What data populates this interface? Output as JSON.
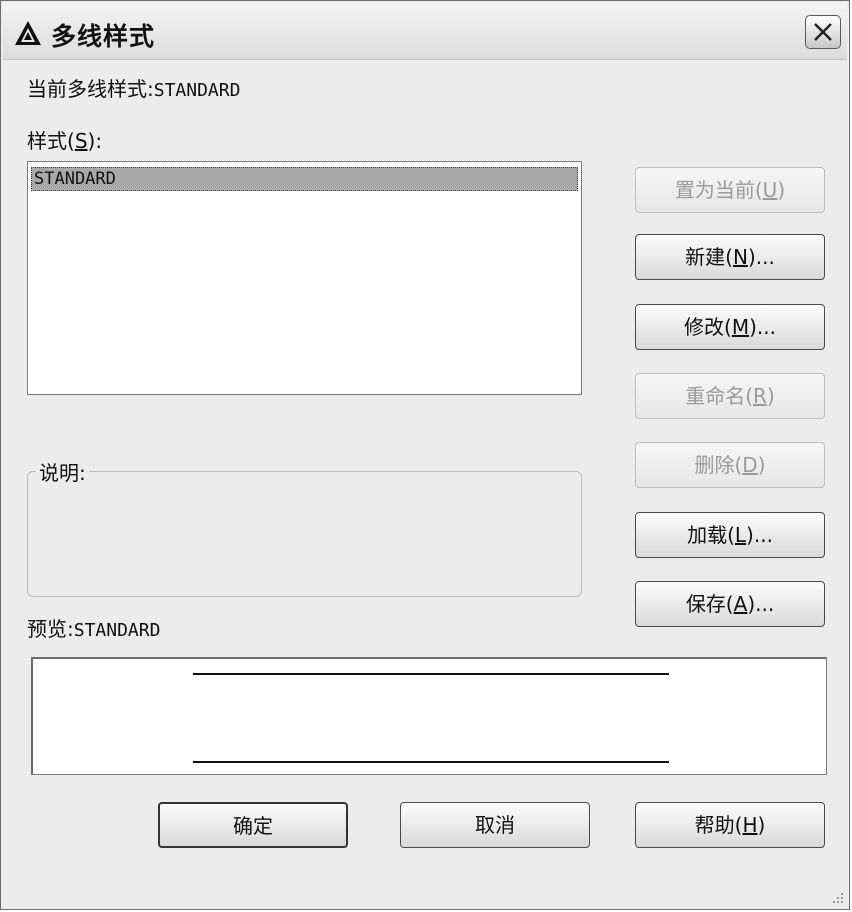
{
  "window": {
    "title": "多线样式",
    "close_icon": "close-icon",
    "app_icon": "autocad-logo-icon"
  },
  "current_style": {
    "label": "当前多线样式:",
    "value": "STANDARD"
  },
  "styles": {
    "label_prefix": "样式(",
    "hotkey": "S",
    "label_suffix": "):",
    "items": [
      "STANDARD"
    ],
    "selected": "STANDARD"
  },
  "buttons": {
    "set_current": {
      "prefix": "置为当前(",
      "hotkey": "U",
      "suffix": ")",
      "enabled": false
    },
    "new": {
      "prefix": "新建(",
      "hotkey": "N",
      "suffix": ")...",
      "enabled": true
    },
    "modify": {
      "prefix": "修改(",
      "hotkey": "M",
      "suffix": ")...",
      "enabled": true
    },
    "rename": {
      "prefix": "重命名(",
      "hotkey": "R",
      "suffix": ")",
      "enabled": false
    },
    "delete": {
      "prefix": "删除(",
      "hotkey": "D",
      "suffix": ")",
      "enabled": false
    },
    "load": {
      "prefix": "加载(",
      "hotkey": "L",
      "suffix": ")...",
      "enabled": true
    },
    "save": {
      "prefix": "保存(",
      "hotkey": "A",
      "suffix": ")...",
      "enabled": true
    }
  },
  "description": {
    "label": "说明:",
    "value": ""
  },
  "preview": {
    "label": "预览:",
    "value": "STANDARD"
  },
  "footer": {
    "ok": "确定",
    "cancel": "取消",
    "help_prefix": "帮助(",
    "help_hotkey": "H",
    "help_suffix": ")"
  }
}
